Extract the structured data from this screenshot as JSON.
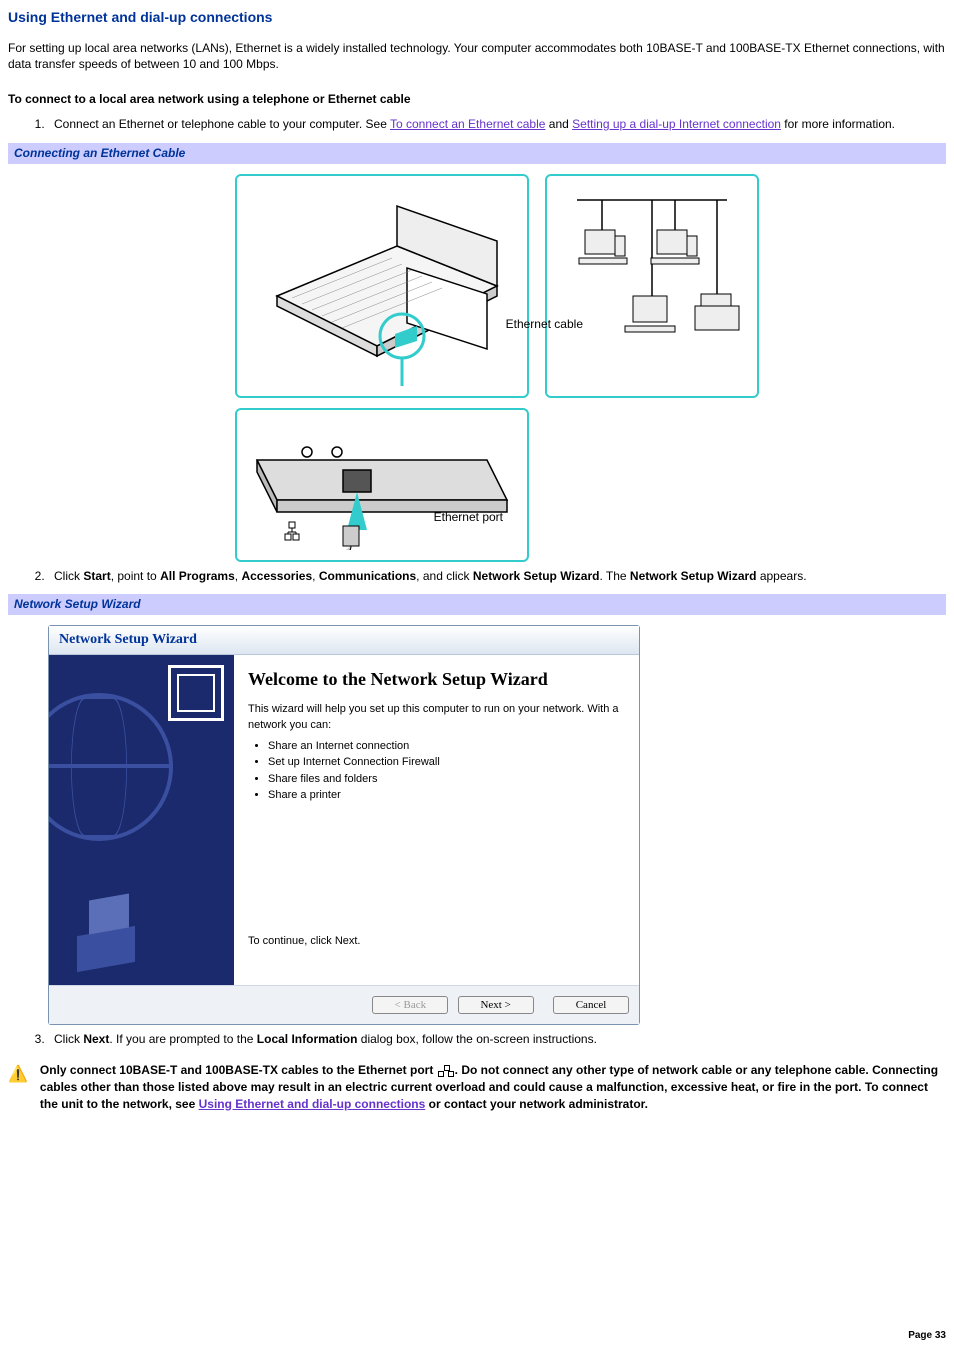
{
  "title": "Using Ethernet and dial-up connections",
  "intro": "For setting up local area networks (LANs), Ethernet is a widely installed technology. Your computer accommodates both 10BASE-T and 100BASE-TX Ethernet connections, with data transfer speeds of between 10 and 100 Mbps.",
  "subheading": "To connect to a local area network using a telephone or Ethernet cable",
  "step1_pre": "Connect an Ethernet or telephone cable to your computer. See ",
  "step1_link1": "To connect an Ethernet cable",
  "step1_mid": " and ",
  "step1_link2": "Setting up a dial-up Internet connection",
  "step1_post": " for more information.",
  "fig1_caption": "Connecting an Ethernet Cable",
  "fig1_label_cable": "Ethernet cable",
  "fig1_label_port": "Ethernet port",
  "step2_pre": "Click ",
  "step2_b1": "Start",
  "step2_t1": ", point to ",
  "step2_b2": "All Programs",
  "step2_t2": ", ",
  "step2_b3": "Accessories",
  "step2_t3": ", ",
  "step2_b4": "Communications",
  "step2_t4": ", and click ",
  "step2_b5": "Network Setup Wizard",
  "step2_t5": ". The ",
  "step2_b6": "Network Setup Wizard",
  "step2_t6": " appears.",
  "fig2_caption": "Network Setup Wizard",
  "wizard": {
    "title": "Network Setup Wizard",
    "heading": "Welcome to the Network Setup Wizard",
    "desc": "This wizard will help you set up this computer to run on your network. With a network you can:",
    "bullets": [
      "Share an Internet connection",
      "Set up Internet Connection Firewall",
      "Share files and folders",
      "Share a printer"
    ],
    "continue": "To continue, click Next.",
    "back": "< Back",
    "next": "Next >",
    "cancel": "Cancel"
  },
  "step3_pre": "Click ",
  "step3_b1": "Next",
  "step3_mid": ". If you are prompted to the ",
  "step3_b2": "Local Information",
  "step3_post": " dialog box, follow the on-screen instructions.",
  "warning_pre": "Only connect 10BASE-T and 100BASE-TX cables to the Ethernet port ",
  "warning_post1": ". Do not connect any other type of network cable or any telephone cable. Connecting cables other than those listed above may result in an electric current overload and could cause a malfunction, excessive heat, or fire in the port. To connect the unit to the network, see ",
  "warning_link": "Using Ethernet and dial-up connections",
  "warning_post2": " or contact your network administrator.",
  "page_num": "Page 33"
}
